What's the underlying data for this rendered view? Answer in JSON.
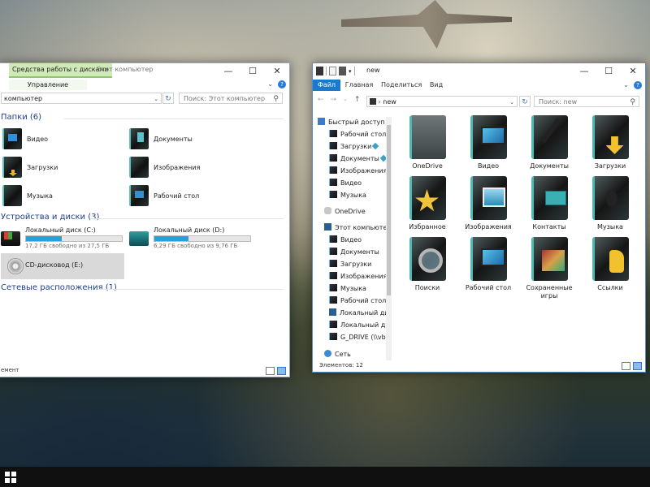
{
  "left_window": {
    "tools_tab": "Средства работы с дисками",
    "title": "Этот компьютер",
    "ribbon_manage": "Управление",
    "address": "компьютер",
    "search_placeholder": "Поиск: Этот компьютер",
    "folders_header": "Папки (6)",
    "folders": [
      {
        "label": "Видео",
        "icon": "videos-folder-icon"
      },
      {
        "label": "Документы",
        "icon": "documents-folder-icon"
      },
      {
        "label": "Загрузки",
        "icon": "downloads-folder-icon"
      },
      {
        "label": "Изображения",
        "icon": "pictures-folder-icon"
      },
      {
        "label": "Музыка",
        "icon": "music-folder-icon"
      },
      {
        "label": "Рабочий стол",
        "icon": "desktop-folder-icon"
      }
    ],
    "devices_header": "Устройства и диски (3)",
    "drives": [
      {
        "name": "Локальный диск (C:)",
        "free": "17,2 ГБ свободно из 27,5 ГБ",
        "used_fraction": 0.37
      },
      {
        "name": "Локальный диск (D:)",
        "free": "6,29 ГБ свободно из 9,76 ГБ",
        "used_fraction": 0.36
      }
    ],
    "cd_drive": "CD-дисковод (E:)",
    "network_header": "Сетевые расположения (1)",
    "status": "емент"
  },
  "right_window": {
    "title": "new",
    "tabs": [
      "Файл",
      "Главная",
      "Поделиться",
      "Вид"
    ],
    "address": "new",
    "search_placeholder": "Поиск: new",
    "nav_items": [
      {
        "label": "Быстрый доступ",
        "pinned": false
      },
      {
        "label": "Рабочий стол",
        "pinned": true
      },
      {
        "label": "Загрузки",
        "pinned": true
      },
      {
        "label": "Документы",
        "pinned": true
      },
      {
        "label": "Изображения",
        "pinned": true
      },
      {
        "label": "Видео",
        "pinned": false
      },
      {
        "label": "Музыка",
        "pinned": false
      },
      {
        "label": "OneDrive",
        "pinned": false
      },
      {
        "label": "Этот компьютер",
        "pinned": false
      },
      {
        "label": "Видео",
        "pinned": false
      },
      {
        "label": "Документы",
        "pinned": false
      },
      {
        "label": "Загрузки",
        "pinned": false
      },
      {
        "label": "Изображения",
        "pinned": false
      },
      {
        "label": "Музыка",
        "pinned": false
      },
      {
        "label": "Рабочий стол",
        "pinned": false
      },
      {
        "label": "Локальный дис",
        "pinned": false
      },
      {
        "label": "Локальный дис",
        "pinned": false
      },
      {
        "label": "G_DRIVE (\\\\vbox",
        "pinned": false
      },
      {
        "label": "Сеть",
        "pinned": false
      }
    ],
    "items": [
      {
        "label": "OneDrive",
        "icon": "onedrive-folder-icon"
      },
      {
        "label": "Видео",
        "icon": "videos-folder-icon"
      },
      {
        "label": "Документы",
        "icon": "documents-folder-icon"
      },
      {
        "label": "Загрузки",
        "icon": "downloads-folder-icon"
      },
      {
        "label": "Избранное",
        "icon": "favorites-folder-icon"
      },
      {
        "label": "Изображения",
        "icon": "pictures-folder-icon"
      },
      {
        "label": "Контакты",
        "icon": "contacts-folder-icon"
      },
      {
        "label": "Музыка",
        "icon": "music-folder-icon"
      },
      {
        "label": "Поиски",
        "icon": "searches-folder-icon"
      },
      {
        "label": "Рабочий стол",
        "icon": "desktop-folder-icon"
      },
      {
        "label": "Сохраненные игры",
        "icon": "saved-games-folder-icon"
      },
      {
        "label": "Ссылки",
        "icon": "links-folder-icon"
      }
    ],
    "status": "Элементов: 12"
  },
  "colors": {
    "accent": "#1979ca",
    "tools_tab": "#cfe9b8",
    "drive_fill": "#26a0da",
    "section_header": "#1e3f8a"
  }
}
